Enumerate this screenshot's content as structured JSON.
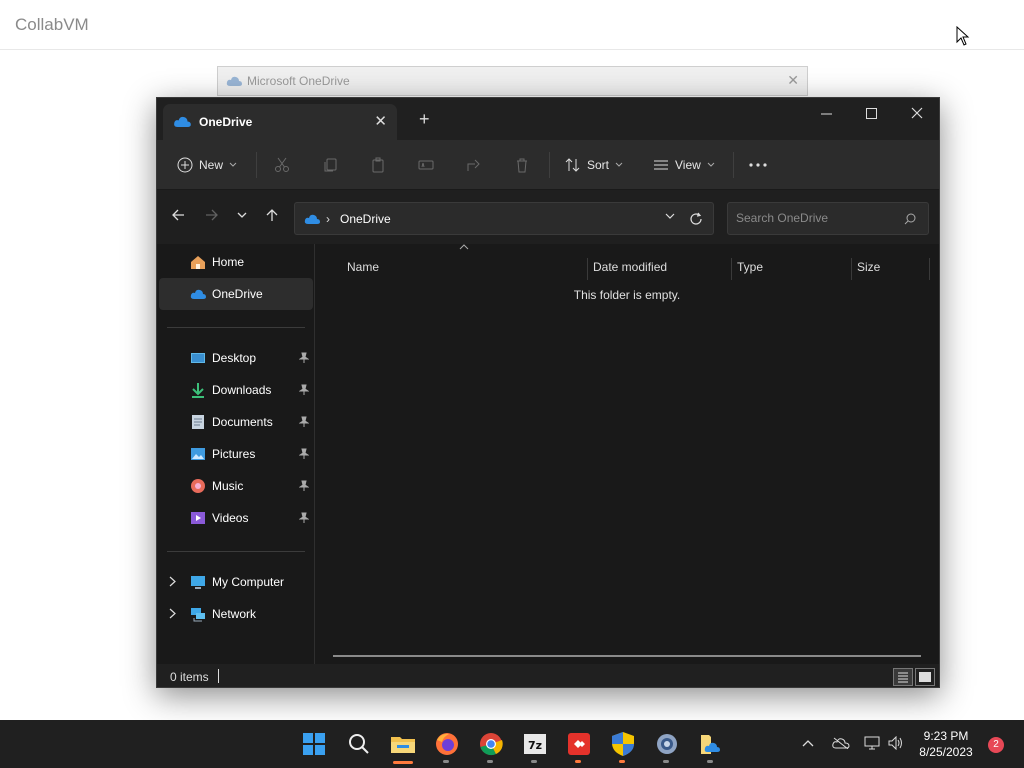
{
  "page": {
    "brand": "CollabVM"
  },
  "background_window": {
    "title": "Microsoft OneDrive"
  },
  "explorer": {
    "tab_title": "OneDrive",
    "toolbar": {
      "new_label": "New",
      "sort_label": "Sort",
      "view_label": "View"
    },
    "address": {
      "location": "OneDrive",
      "search_placeholder": "Search OneDrive"
    },
    "nav": {
      "home": "Home",
      "onedrive": "OneDrive",
      "quick_access": [
        {
          "label": "Desktop",
          "icon": "desktop-icon"
        },
        {
          "label": "Downloads",
          "icon": "downloads-icon"
        },
        {
          "label": "Documents",
          "icon": "documents-icon"
        },
        {
          "label": "Pictures",
          "icon": "pictures-icon"
        },
        {
          "label": "Music",
          "icon": "music-icon"
        },
        {
          "label": "Videos",
          "icon": "videos-icon"
        }
      ],
      "my_computer": "My Computer",
      "network": "Network"
    },
    "columns": {
      "name": "Name",
      "date_modified": "Date modified",
      "type": "Type",
      "size": "Size"
    },
    "empty_message": "This folder is empty.",
    "status": {
      "items": "0 items"
    }
  },
  "taskbar": {
    "clock_time": "9:23 PM",
    "clock_date": "8/25/2023",
    "notification_count": "2",
    "apps": [
      "start-icon",
      "search-icon",
      "file-explorer-icon",
      "firefox-icon",
      "chrome-icon",
      "7zip-icon",
      "anydesk-icon",
      "security-shield-icon",
      "settings-icon",
      "onedrive-folder-icon"
    ]
  },
  "colors": {
    "accent": "#0078d4",
    "onedrive_blue": "#2f8de4",
    "window_bg": "#191919",
    "toolbar_bg": "#2c2c2c"
  }
}
